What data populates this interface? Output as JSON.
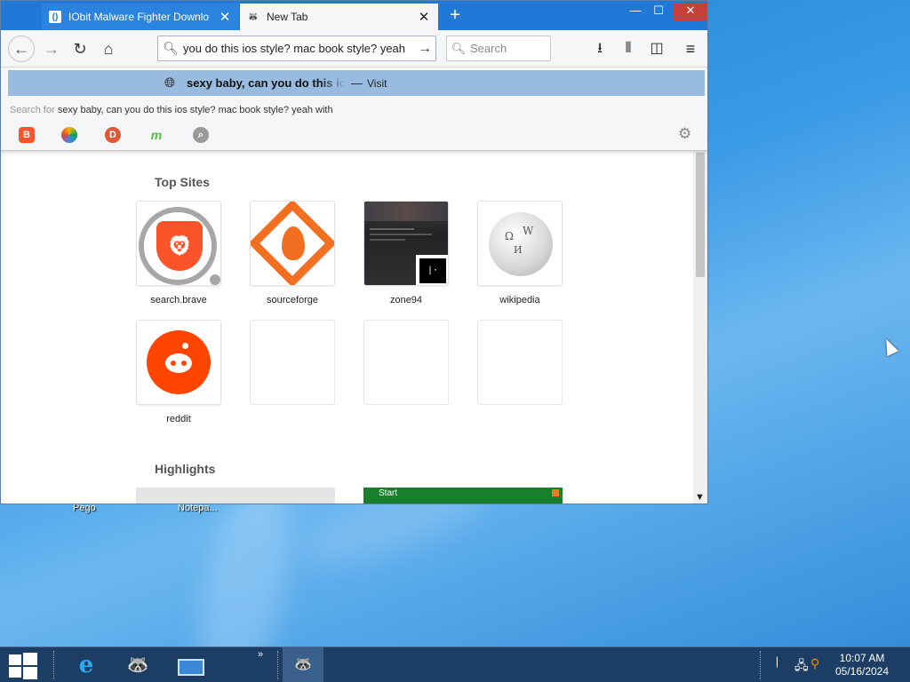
{
  "desktop": {
    "icons": [
      {
        "label": "Pego"
      },
      {
        "label": "Notepa..."
      }
    ]
  },
  "browser": {
    "tabs": [
      {
        "title": "IObit Malware Fighter Downlo",
        "active": false,
        "favicon": "iobit-icon"
      },
      {
        "title": "New Tab",
        "active": true,
        "favicon": "raccoon-icon"
      }
    ],
    "new_tab": "+",
    "window_controls": {
      "minimize": "—",
      "maximize": "☐",
      "close": "✕"
    },
    "url_value": "you do this ios style? mac book style? yeah",
    "search_placeholder": "Search",
    "suggestion": {
      "text": "sexy baby, can you do this ic",
      "dash": "—",
      "visit": "Visit"
    },
    "search_for_prefix": "Search for",
    "search_for_query": "sexy baby, can you do this ios style? mac book style? yeah with",
    "engines": [
      "brave-icon",
      "qwant-icon",
      "duckduckgo-icon",
      "mojeek-icon",
      "search-engine-icon"
    ],
    "top_sites_title": "Top Sites",
    "top_sites": [
      {
        "label": "search.brave"
      },
      {
        "label": "sourceforge"
      },
      {
        "label": "zone94"
      },
      {
        "label": "wikipedia"
      },
      {
        "label": "reddit"
      }
    ],
    "highlights_title": "Highlights",
    "highlight_start": "Start"
  },
  "taskbar": {
    "time": "10:07 AM",
    "date": "05/16/2024"
  }
}
